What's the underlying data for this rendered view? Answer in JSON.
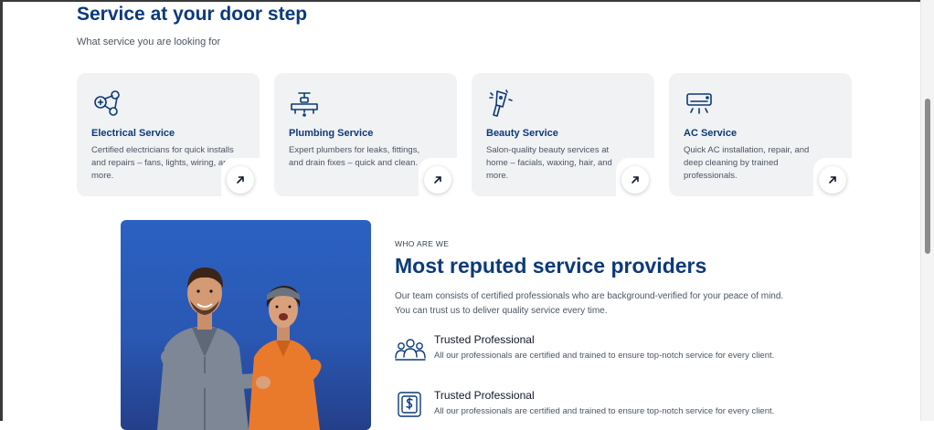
{
  "services": {
    "title": "Service at your door step",
    "subtitle": "What service you are looking for",
    "cards": [
      {
        "title": "Electrical Service",
        "description": "Certified electricians for quick installs and repairs – fans, lights, wiring, and more.",
        "icon": "electrical-icon"
      },
      {
        "title": "Plumbing Service",
        "description": "Expert plumbers for leaks, fittings, and drain fixes – quick and clean.",
        "icon": "plumbing-icon"
      },
      {
        "title": "Beauty Service",
        "description": "Salon-quality beauty services at home – facials, waxing, hair, and more.",
        "icon": "beauty-icon"
      },
      {
        "title": "AC Service",
        "description": "Quick AC installation, repair, and deep cleaning by trained professionals.",
        "icon": "ac-icon"
      }
    ]
  },
  "about": {
    "eyebrow": "WHO ARE WE",
    "title": "Most reputed service providers",
    "text": "Our team consists of certified professionals who are background-verified for your peace of mind. You can trust us to deliver quality service every time.",
    "features": [
      {
        "title": "Trusted Professional",
        "description": "All our professionals are certified and trained to ensure top-notch service for every client.",
        "icon": "team-icon"
      },
      {
        "title": "Trusted Professional",
        "description": "All our professionals are certified and trained to ensure top-notch service for every client.",
        "icon": "payment-icon"
      }
    ]
  },
  "colors": {
    "brand": "#0b3a79",
    "card_bg": "#f1f2f4",
    "hero_blue": "#2b61c2"
  }
}
